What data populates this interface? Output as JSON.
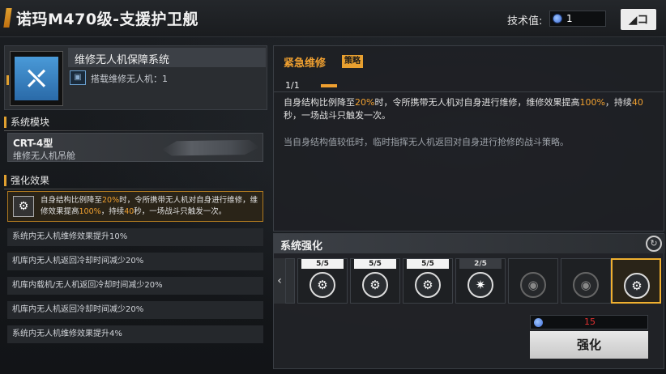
{
  "header": {
    "title": "诺玛M470级-支援护卫舰",
    "tech_label": "技术值:",
    "tech_value": "1",
    "back_label": "◢コ"
  },
  "system": {
    "icon_glyph": "⛌",
    "name": "维修无人机保障系统",
    "sub_text": "搭载维修无人机：1"
  },
  "modules": {
    "heading": "系统模块",
    "name": "CRT-4型",
    "subtitle": "维修无人机吊舱"
  },
  "enhancement_effect": {
    "heading": "强化效果",
    "icon_glyph": "⚙",
    "p1": "自身结构比例降至",
    "v1": "20%",
    "p2": "时，令所携带无人机对自身进行维修，维修效果提高",
    "v2": "100%",
    "p3": "，持续",
    "v3": "40",
    "p4": "秒，一场战斗只触发一次。"
  },
  "bonus_list": [
    "系统内无人机维修效果提升10%",
    "机库内无人机返回冷却时间减少20%",
    "机库内载机/无人机返回冷却时间减少20%",
    "机库内无人机返回冷却时间减少20%",
    "系统内无人机维修效果提升4%"
  ],
  "detail": {
    "title": "紧急维修",
    "tag": "策略",
    "level": "1/1",
    "desc_p1": "自身结构比例降至",
    "desc_v1": "20%",
    "desc_p2": "时，令所携带无人机对自身进行维修，维修效果提高",
    "desc_v2": "100%",
    "desc_p3": "，持续",
    "desc_v3": "40",
    "desc_p4": "秒，一场战斗只触发一次。",
    "desc_secondary": "当自身结构值较低时，临时指挥无人机返回对自身进行抢修的战斗策略。"
  },
  "system_enhance": {
    "heading": "系统强化",
    "nav_left": "‹",
    "refresh_glyph": "↻",
    "slots": [
      {
        "count": "5/5",
        "glyph": "⚙"
      },
      {
        "count": "5/5",
        "glyph": "⚙"
      },
      {
        "count": "5/5",
        "glyph": "⚙"
      },
      {
        "count": "2/5",
        "glyph": "✷"
      },
      {
        "count": "",
        "glyph": "◉"
      },
      {
        "count": "",
        "glyph": "◉"
      },
      {
        "count": "",
        "glyph": "⚙"
      }
    ],
    "cost": "15",
    "button_label": "强化"
  },
  "colors": {
    "accent": "#f0a030",
    "cost_red": "#e03030"
  }
}
